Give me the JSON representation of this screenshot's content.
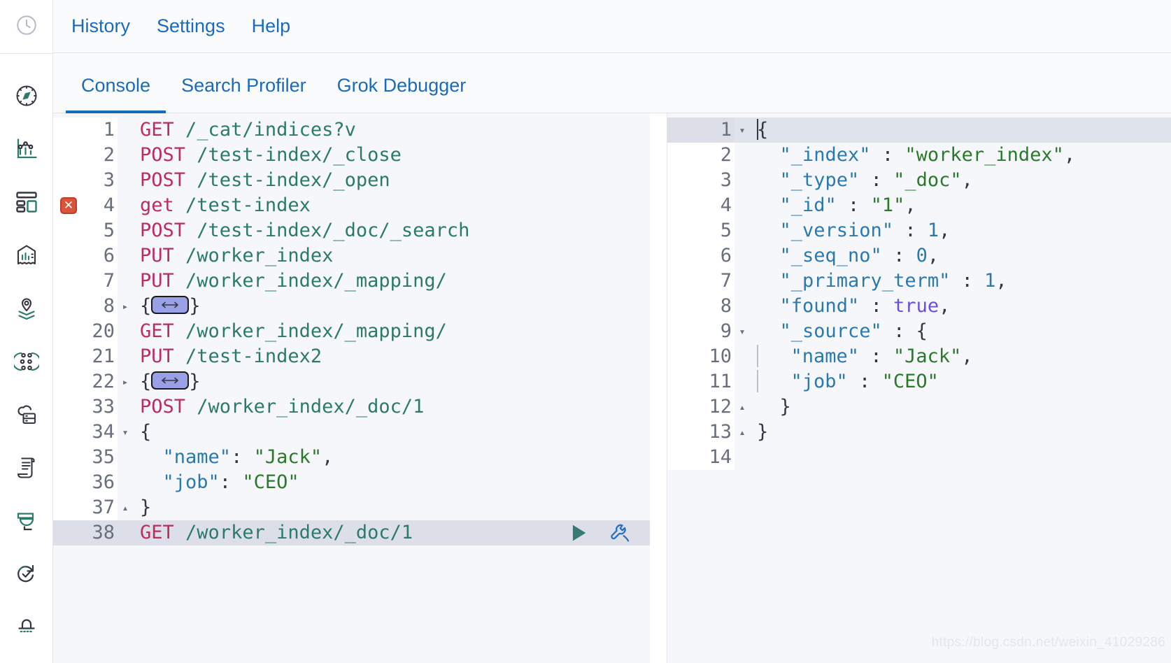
{
  "rail": {
    "top_icon": "recently-viewed-clock-icon",
    "items": [
      {
        "icon": "compass-discover-icon",
        "label": "Discover"
      },
      {
        "icon": "bar-chart-visualize-icon",
        "label": "Visualize"
      },
      {
        "icon": "dashboard-grid-icon",
        "label": "Dashboard"
      },
      {
        "icon": "canvas-icon",
        "label": "Canvas"
      },
      {
        "icon": "maps-pin-layers-icon",
        "label": "Maps"
      },
      {
        "icon": "graph-nodes-icon",
        "label": "Graph"
      },
      {
        "icon": "machine-learning-cloud-icon",
        "label": "Machine Learning"
      },
      {
        "icon": "logs-scroll-icon",
        "label": "Logs"
      },
      {
        "icon": "apm-icon",
        "label": "APM"
      },
      {
        "icon": "uptime-check-icon",
        "label": "Uptime"
      },
      {
        "icon": "siem-shield-icon",
        "label": "SIEM"
      }
    ]
  },
  "topnav": {
    "links": [
      {
        "label": "History"
      },
      {
        "label": "Settings"
      },
      {
        "label": "Help"
      }
    ]
  },
  "tabs": [
    {
      "label": "Console",
      "active": true
    },
    {
      "label": "Search Profiler",
      "active": false
    },
    {
      "label": "Grok Debugger",
      "active": false
    }
  ],
  "request_editor": {
    "name": "console-request-editor",
    "lines": [
      {
        "num": "1",
        "fold": "",
        "error": false,
        "highlight": false,
        "tokens": [
          {
            "t": "m",
            "v": "GET"
          },
          {
            "t": "sp",
            "v": " "
          },
          {
            "t": "u",
            "v": "/_cat/indices?v"
          }
        ]
      },
      {
        "num": "2",
        "fold": "",
        "error": false,
        "highlight": false,
        "tokens": [
          {
            "t": "m",
            "v": "POST"
          },
          {
            "t": "sp",
            "v": " "
          },
          {
            "t": "u",
            "v": "/test-index/_close"
          }
        ]
      },
      {
        "num": "3",
        "fold": "",
        "error": false,
        "highlight": false,
        "tokens": [
          {
            "t": "m",
            "v": "POST"
          },
          {
            "t": "sp",
            "v": " "
          },
          {
            "t": "u",
            "v": "/test-index/_open"
          }
        ]
      },
      {
        "num": "4",
        "fold": "",
        "error": true,
        "highlight": false,
        "tokens": [
          {
            "t": "m",
            "v": "get"
          },
          {
            "t": "sp",
            "v": " "
          },
          {
            "t": "u",
            "v": "/test-index"
          }
        ]
      },
      {
        "num": "5",
        "fold": "",
        "error": false,
        "highlight": false,
        "tokens": [
          {
            "t": "m",
            "v": "POST"
          },
          {
            "t": "sp",
            "v": " "
          },
          {
            "t": "u",
            "v": "/test-index/_doc/_search"
          }
        ]
      },
      {
        "num": "6",
        "fold": "",
        "error": false,
        "highlight": false,
        "tokens": [
          {
            "t": "m",
            "v": "PUT"
          },
          {
            "t": "sp",
            "v": " "
          },
          {
            "t": "u",
            "v": "/worker_index"
          }
        ]
      },
      {
        "num": "7",
        "fold": "",
        "error": false,
        "highlight": false,
        "tokens": [
          {
            "t": "m",
            "v": "PUT"
          },
          {
            "t": "sp",
            "v": " "
          },
          {
            "t": "u",
            "v": "/worker_index/_mapping/"
          }
        ]
      },
      {
        "num": "8",
        "fold": "closed",
        "error": false,
        "highlight": false,
        "folded": true,
        "tokens": [
          {
            "t": "p",
            "v": "{"
          },
          {
            "t": "foldbadge",
            "v": "…"
          },
          {
            "t": "p",
            "v": "}"
          }
        ]
      },
      {
        "num": "20",
        "fold": "",
        "error": false,
        "highlight": false,
        "tokens": [
          {
            "t": "m",
            "v": "GET"
          },
          {
            "t": "sp",
            "v": " "
          },
          {
            "t": "u",
            "v": "/worker_index/_mapping/"
          }
        ]
      },
      {
        "num": "21",
        "fold": "",
        "error": false,
        "highlight": false,
        "tokens": [
          {
            "t": "m",
            "v": "PUT"
          },
          {
            "t": "sp",
            "v": " "
          },
          {
            "t": "u",
            "v": "/test-index2"
          }
        ]
      },
      {
        "num": "22",
        "fold": "closed",
        "error": false,
        "highlight": false,
        "folded": true,
        "tokens": [
          {
            "t": "p",
            "v": "{"
          },
          {
            "t": "foldbadge",
            "v": "…"
          },
          {
            "t": "p",
            "v": "}"
          }
        ]
      },
      {
        "num": "33",
        "fold": "",
        "error": false,
        "highlight": false,
        "tokens": [
          {
            "t": "m",
            "v": "POST"
          },
          {
            "t": "sp",
            "v": " "
          },
          {
            "t": "u",
            "v": "/worker_index/_doc/1"
          }
        ]
      },
      {
        "num": "34",
        "fold": "open",
        "error": false,
        "highlight": false,
        "tokens": [
          {
            "t": "p",
            "v": "{"
          }
        ]
      },
      {
        "num": "35",
        "fold": "",
        "error": false,
        "highlight": false,
        "tokens": [
          {
            "t": "p",
            "v": "  "
          },
          {
            "t": "k",
            "v": "\"name\""
          },
          {
            "t": "p",
            "v": ": "
          },
          {
            "t": "s",
            "v": "\"Jack\""
          },
          {
            "t": "p",
            "v": ","
          }
        ]
      },
      {
        "num": "36",
        "fold": "",
        "error": false,
        "highlight": false,
        "tokens": [
          {
            "t": "p",
            "v": "  "
          },
          {
            "t": "k",
            "v": "\"job\""
          },
          {
            "t": "p",
            "v": ": "
          },
          {
            "t": "s",
            "v": "\"CEO\""
          }
        ]
      },
      {
        "num": "37",
        "fold": "end",
        "error": false,
        "highlight": false,
        "tokens": [
          {
            "t": "p",
            "v": "}"
          }
        ]
      },
      {
        "num": "38",
        "fold": "",
        "error": false,
        "highlight": true,
        "has_actions": true,
        "tokens": [
          {
            "t": "m",
            "v": "GET"
          },
          {
            "t": "sp",
            "v": " "
          },
          {
            "t": "u",
            "v": "/worker_index/_doc/1"
          }
        ]
      }
    ],
    "actions": {
      "play": "play-request-icon",
      "wrench": "request-options-wrench-icon"
    }
  },
  "response_editor": {
    "name": "console-response-viewer",
    "lines": [
      {
        "num": "1",
        "fold": "open",
        "highlight": true,
        "caret": true,
        "tokens": [
          {
            "t": "p",
            "v": "{"
          }
        ]
      },
      {
        "num": "2",
        "fold": "",
        "highlight": false,
        "tokens": [
          {
            "t": "p",
            "v": "  "
          },
          {
            "t": "k",
            "v": "\"_index\""
          },
          {
            "t": "p",
            "v": " : "
          },
          {
            "t": "s",
            "v": "\"worker_index\""
          },
          {
            "t": "p",
            "v": ","
          }
        ]
      },
      {
        "num": "3",
        "fold": "",
        "highlight": false,
        "tokens": [
          {
            "t": "p",
            "v": "  "
          },
          {
            "t": "k",
            "v": "\"_type\""
          },
          {
            "t": "p",
            "v": " : "
          },
          {
            "t": "s",
            "v": "\"_doc\""
          },
          {
            "t": "p",
            "v": ","
          }
        ]
      },
      {
        "num": "4",
        "fold": "",
        "highlight": false,
        "tokens": [
          {
            "t": "p",
            "v": "  "
          },
          {
            "t": "k",
            "v": "\"_id\""
          },
          {
            "t": "p",
            "v": " : "
          },
          {
            "t": "s",
            "v": "\"1\""
          },
          {
            "t": "p",
            "v": ","
          }
        ]
      },
      {
        "num": "5",
        "fold": "",
        "highlight": false,
        "tokens": [
          {
            "t": "p",
            "v": "  "
          },
          {
            "t": "k",
            "v": "\"_version\""
          },
          {
            "t": "p",
            "v": " : "
          },
          {
            "t": "n",
            "v": "1"
          },
          {
            "t": "p",
            "v": ","
          }
        ]
      },
      {
        "num": "6",
        "fold": "",
        "highlight": false,
        "tokens": [
          {
            "t": "p",
            "v": "  "
          },
          {
            "t": "k",
            "v": "\"_seq_no\""
          },
          {
            "t": "p",
            "v": " : "
          },
          {
            "t": "n",
            "v": "0"
          },
          {
            "t": "p",
            "v": ","
          }
        ]
      },
      {
        "num": "7",
        "fold": "",
        "highlight": false,
        "tokens": [
          {
            "t": "p",
            "v": "  "
          },
          {
            "t": "k",
            "v": "\"_primary_term\""
          },
          {
            "t": "p",
            "v": " : "
          },
          {
            "t": "n",
            "v": "1"
          },
          {
            "t": "p",
            "v": ","
          }
        ]
      },
      {
        "num": "8",
        "fold": "",
        "highlight": false,
        "tokens": [
          {
            "t": "p",
            "v": "  "
          },
          {
            "t": "k",
            "v": "\"found\""
          },
          {
            "t": "p",
            "v": " : "
          },
          {
            "t": "b",
            "v": "true"
          },
          {
            "t": "p",
            "v": ","
          }
        ]
      },
      {
        "num": "9",
        "fold": "open",
        "highlight": false,
        "tokens": [
          {
            "t": "p",
            "v": "  "
          },
          {
            "t": "k",
            "v": "\"_source\""
          },
          {
            "t": "p",
            "v": " : {"
          }
        ]
      },
      {
        "num": "10",
        "fold": "",
        "highlight": false,
        "guide": true,
        "tokens": [
          {
            "t": "p",
            "v": "  "
          },
          {
            "t": "k",
            "v": "\"name\""
          },
          {
            "t": "p",
            "v": " : "
          },
          {
            "t": "s",
            "v": "\"Jack\""
          },
          {
            "t": "p",
            "v": ","
          }
        ]
      },
      {
        "num": "11",
        "fold": "",
        "highlight": false,
        "guide": true,
        "tokens": [
          {
            "t": "p",
            "v": "  "
          },
          {
            "t": "k",
            "v": "\"job\""
          },
          {
            "t": "p",
            "v": " : "
          },
          {
            "t": "s",
            "v": "\"CEO\""
          }
        ]
      },
      {
        "num": "12",
        "fold": "end",
        "highlight": false,
        "tokens": [
          {
            "t": "p",
            "v": "  }"
          }
        ]
      },
      {
        "num": "13",
        "fold": "end",
        "highlight": false,
        "tokens": [
          {
            "t": "p",
            "v": "}"
          }
        ]
      },
      {
        "num": "14",
        "fold": "",
        "highlight": false,
        "tokens": []
      }
    ]
  },
  "watermark": {
    "text": "https://blog.csdn.net/weixin_41029286"
  },
  "colors": {
    "link_blue": "#1a6bbd",
    "method_pink": "#bd2c5e",
    "url_teal": "#2c7a6c",
    "json_key_blue": "#2a7ab0",
    "json_string_green": "#2a7a2a",
    "boolean_purple": "#6b4fe0",
    "play_teal": "#357b74",
    "error_red": "#d9543b",
    "editor_bg": "#f5f7fb",
    "highlight_row": "#dcdfe8"
  }
}
